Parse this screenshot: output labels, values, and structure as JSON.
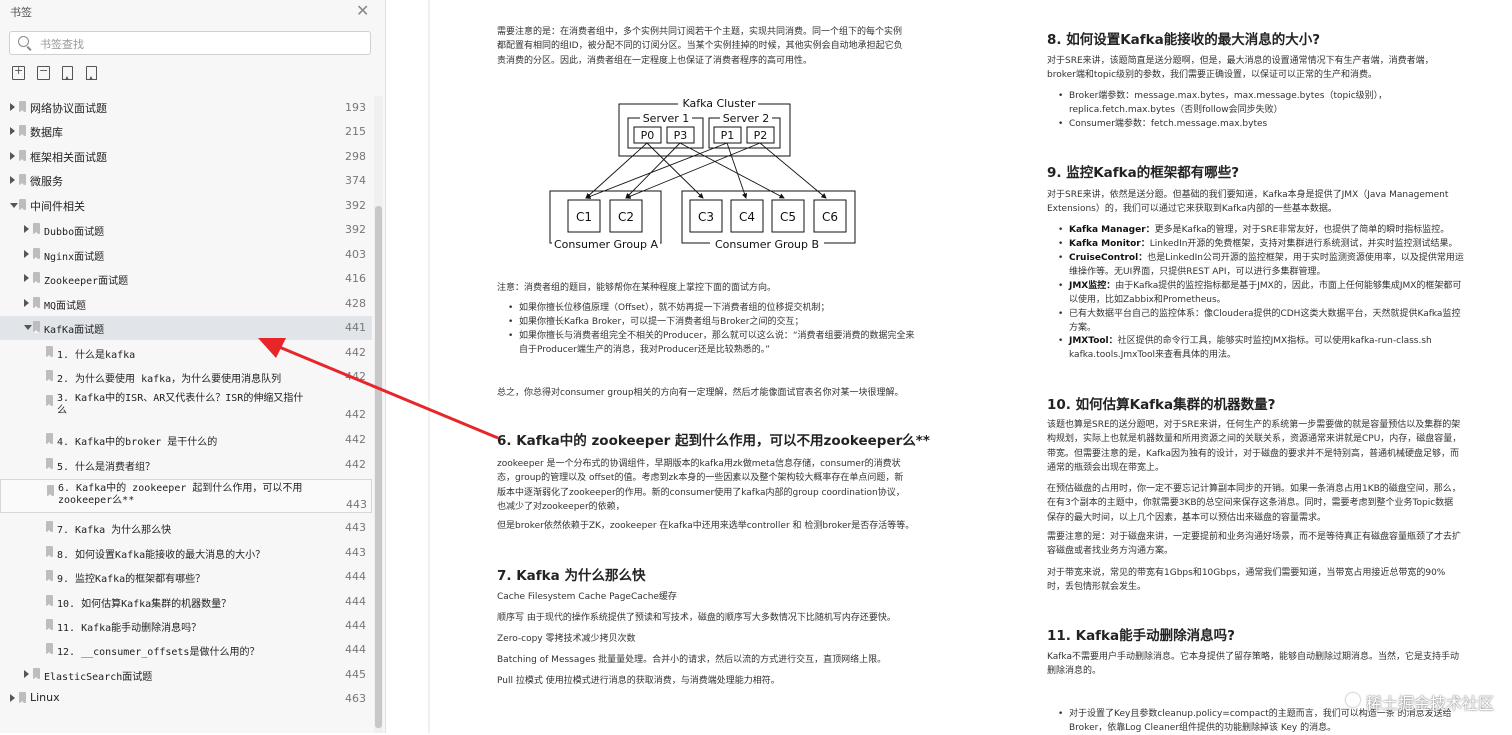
{
  "sidebar": {
    "title": "书签",
    "search_placeholder": "书签查找",
    "items": [
      {
        "label": "网络协议面试题",
        "page": "193",
        "level": 0,
        "expanded": false
      },
      {
        "label": "数据库",
        "page": "215",
        "level": 0,
        "expanded": false
      },
      {
        "label": "框架相关面试题",
        "page": "298",
        "level": 0,
        "expanded": false
      },
      {
        "label": "微服务",
        "page": "374",
        "level": 0,
        "expanded": false
      },
      {
        "label": "中间件相关",
        "page": "392",
        "level": 0,
        "expanded": true
      },
      {
        "label": "Dubbo面试题",
        "page": "392",
        "level": 1,
        "expanded": false
      },
      {
        "label": "Nginx面试题",
        "page": "403",
        "level": 1,
        "expanded": false
      },
      {
        "label": "Zookeeper面试题",
        "page": "416",
        "level": 1,
        "expanded": false
      },
      {
        "label": "MQ面试题",
        "page": "428",
        "level": 1,
        "expanded": false
      },
      {
        "label": "KafKa面试题",
        "page": "441",
        "level": 1,
        "expanded": true
      },
      {
        "label": "1. 什么是kafka",
        "page": "442",
        "level": 2
      },
      {
        "label": "2. 为什么要使用 kafka，为什么要使用消息队列",
        "page": "442",
        "level": 2
      },
      {
        "label": "3. Kafka中的ISR、AR又代表什么？ISR的伸缩又指什么",
        "page": "442",
        "level": 2
      },
      {
        "label": "4. Kafka中的broker 是干什么的",
        "page": "442",
        "level": 2
      },
      {
        "label": "5. 什么是消费者组？",
        "page": "442",
        "level": 2
      },
      {
        "label": "6. Kafka中的 zookeeper 起到什么作用，可以不用zookeeper么**",
        "page": "443",
        "level": 2
      },
      {
        "label": "7. Kafka 为什么那么快",
        "page": "443",
        "level": 2
      },
      {
        "label": "8. 如何设置Kafka能接收的最大消息的大小？",
        "page": "443",
        "level": 2
      },
      {
        "label": "9. 监控Kafka的框架都有哪些？",
        "page": "444",
        "level": 2
      },
      {
        "label": "10. 如何估算Kafka集群的机器数量？",
        "page": "444",
        "level": 2
      },
      {
        "label": "11. Kafka能手动删除消息吗？",
        "page": "444",
        "level": 2
      },
      {
        "label": "12. __consumer_offsets是做什么用的？",
        "page": "444",
        "level": 2
      },
      {
        "label": "ElasticSearch面试题",
        "page": "445",
        "level": 1,
        "expanded": false
      },
      {
        "label": "Linux",
        "page": "463",
        "level": 0,
        "expanded": false
      }
    ]
  },
  "doc_left": {
    "p1": "需要注意的是：在消费者组中，多个实例共同订阅若干个主题，实现共同消费。同一个组下的每个实例都配置有相同的组ID，被分配不同的订阅分区。当某个实例挂掉的时候，其他实例会自动地承担起它负责消费的分区。因此，消费者组在一定程度上也保证了消费者程序的高可用性。",
    "diagram": {
      "cluster": "Kafka Cluster",
      "server1": "Server 1",
      "server2": "Server 2",
      "p0": "P0",
      "p3": "P3",
      "p1": "P1",
      "p2": "P2",
      "c1": "C1",
      "c2": "C2",
      "c3": "C3",
      "c4": "C4",
      "c5": "C5",
      "c6": "C6",
      "group_a": "Consumer Group A",
      "group_b": "Consumer Group B"
    },
    "note": "注意：消费者组的题目，能够帮你在某种程度上掌控下面的面试方向。",
    "bullets1": [
      "如果你擅长位移值原理（Offset），就不妨再提一下消费者组的位移提交机制；",
      "如果你擅长Kafka Broker，可以提一下消费者组与Broker之间的交互；",
      "如果你擅长与消费者组完全不相关的Producer，那么就可以这么说：“消费者组要消费的数据完全来自于Producer端生产的消息，我对Producer还是比较熟悉的。”"
    ],
    "summary": "总之，你总得对consumer group相关的方向有一定理解，然后才能像面试官表名你对某一块很理解。",
    "h6": "6. Kafka中的 zookeeper 起到什么作用，可以不用zookeeper么**",
    "p6a": "zookeeper 是一个分布式的协调组件，早期版本的kafka用zk做meta信息存储，consumer的消费状态，group的管理以及 offset的值。考虑到zk本身的一些因素以及整个架构较大概率存在单点问题，新版本中逐渐弱化了zookeeper的作用。新的consumer使用了kafka内部的group coordination协议，也减少了对zookeeper的依赖，",
    "p6b": "但是broker依然依赖于ZK，zookeeper 在kafka中还用来选举controller 和 检测broker是否存活等等。",
    "h7": "7. Kafka 为什么那么快",
    "l7": [
      "Cache Filesystem Cache PageCache缓存",
      "顺序写 由于现代的操作系统提供了预读和写技术，磁盘的顺序写大多数情况下比随机写内存还要快。",
      "Zero-copy 零拷技术减少拷贝次数",
      "Batching of Messages 批量量处理。合并小的请求，然后以流的方式进行交互，直顶网络上限。",
      "Pull 拉模式 使用拉模式进行消息的获取消费，与消费端处理能力相符。"
    ]
  },
  "doc_right": {
    "h8": "8. 如何设置Kafka能接收的最大消息的大小?",
    "p8": "对于SRE来讲，该题简直是送分题啊，但是，最大消息的设置通常情况下有生产者端，消费者端，broker端和topic级别的参数，我们需要正确设置，以保证可以正常的生产和消费。",
    "b8": [
      "Broker端参数：message.max.bytes，max.message.bytes（topic级别），replica.fetch.max.bytes（否则follow会同步失败）",
      "Consumer端参数：fetch.message.max.bytes"
    ],
    "h9": "9. 监控Kafka的框架都有哪些?",
    "p9": "对于SRE来讲，依然是送分题。但基础的我们要知道，Kafka本身是提供了JMX（Java Management Extensions）的，我们可以通过它来获取到Kafka内部的一些基本数据。",
    "b9": [
      {
        "k": "Kafka Manager：",
        "v": "更多是Kafka的管理，对于SRE非常友好，也提供了简单的瞬时指标监控。"
      },
      {
        "k": "Kafka Monitor：",
        "v": "LinkedIn开源的免费框架，支持对集群进行系统测试，并实时监控测试结果。"
      },
      {
        "k": "CruiseControl：",
        "v": "也是LinkedIn公司开源的监控框架，用于实时监测资源使用率，以及提供常用运维操作等。无UI界面，只提供REST API，可以进行多集群管理。"
      },
      {
        "k": "JMX监控：",
        "v": "由于Kafka提供的监控指标都是基于JMX的，因此，市面上任何能够集成JMX的框架都可以使用，比如Zabbix和Prometheus。"
      },
      {
        "k": "",
        "v": "已有大数据平台自己的监控体系：像Cloudera提供的CDH这类大数据平台，天然就提供Kafka监控方案。"
      },
      {
        "k": "JMXTool：",
        "v": "社区提供的命令行工具，能够实时监控JMX指标。可以使用kafka-run-class.sh kafka.tools.JmxTool来查看具体的用法。"
      }
    ],
    "h10": "10. 如何估算Kafka集群的机器数量?",
    "p10a": "该题也算是SRE的送分题吧，对于SRE来讲，任何生产的系统第一步需要做的就是容量预估以及集群的架构规划，实际上也就是机器数量和所用资源之间的关联关系，资源通常来讲就是CPU，内存，磁盘容量，带宽。但需要注意的是，Kafka因为独有的设计，对于磁盘的要求并不是特别高，普通机械硬盘足够，而通常的瓶颈会出现在带宽上。",
    "p10b": "在预估磁盘的占用时，你一定不要忘记计算副本同步的开销。如果一条消息占用1KB的磁盘空间，那么，在有3个副本的主题中，你就需要3KB的总空间来保存这条消息。同时，需要考虑到整个业务Topic数据保存的最大时间，以上几个因素，基本可以预估出来磁盘的容量需求。",
    "p10c": "需要注意的是：对于磁盘来讲，一定要提前和业务沟通好场景，而不是等待真正有磁盘容量瓶颈了才去扩容磁盘或者找业务方沟通方案。",
    "p10d": "对于带宽来说，常见的带宽有1Gbps和10Gbps，通常我们需要知道，当带宽占用接近总带宽的90%时，丢包情形就会发生。",
    "h11": "11. Kafka能手动删除消息吗?",
    "p11": "Kafka不需要用户手动删除消息。它本身提供了留存策略，能够自动删除过期消息。当然，它是支持手动删除消息的。",
    "b11": "对于设置了Key且参数cleanup.policy=compact的主题而言，我们可以构造一条 的消息发送给Broker，依靠Log Cleaner组件提供的功能删除掉该 Key 的消息。"
  },
  "watermark": "稀土掘金技术社区",
  "colors": {
    "accent_arrow": "#e8262a",
    "selected_row": "#e1e4e8"
  }
}
